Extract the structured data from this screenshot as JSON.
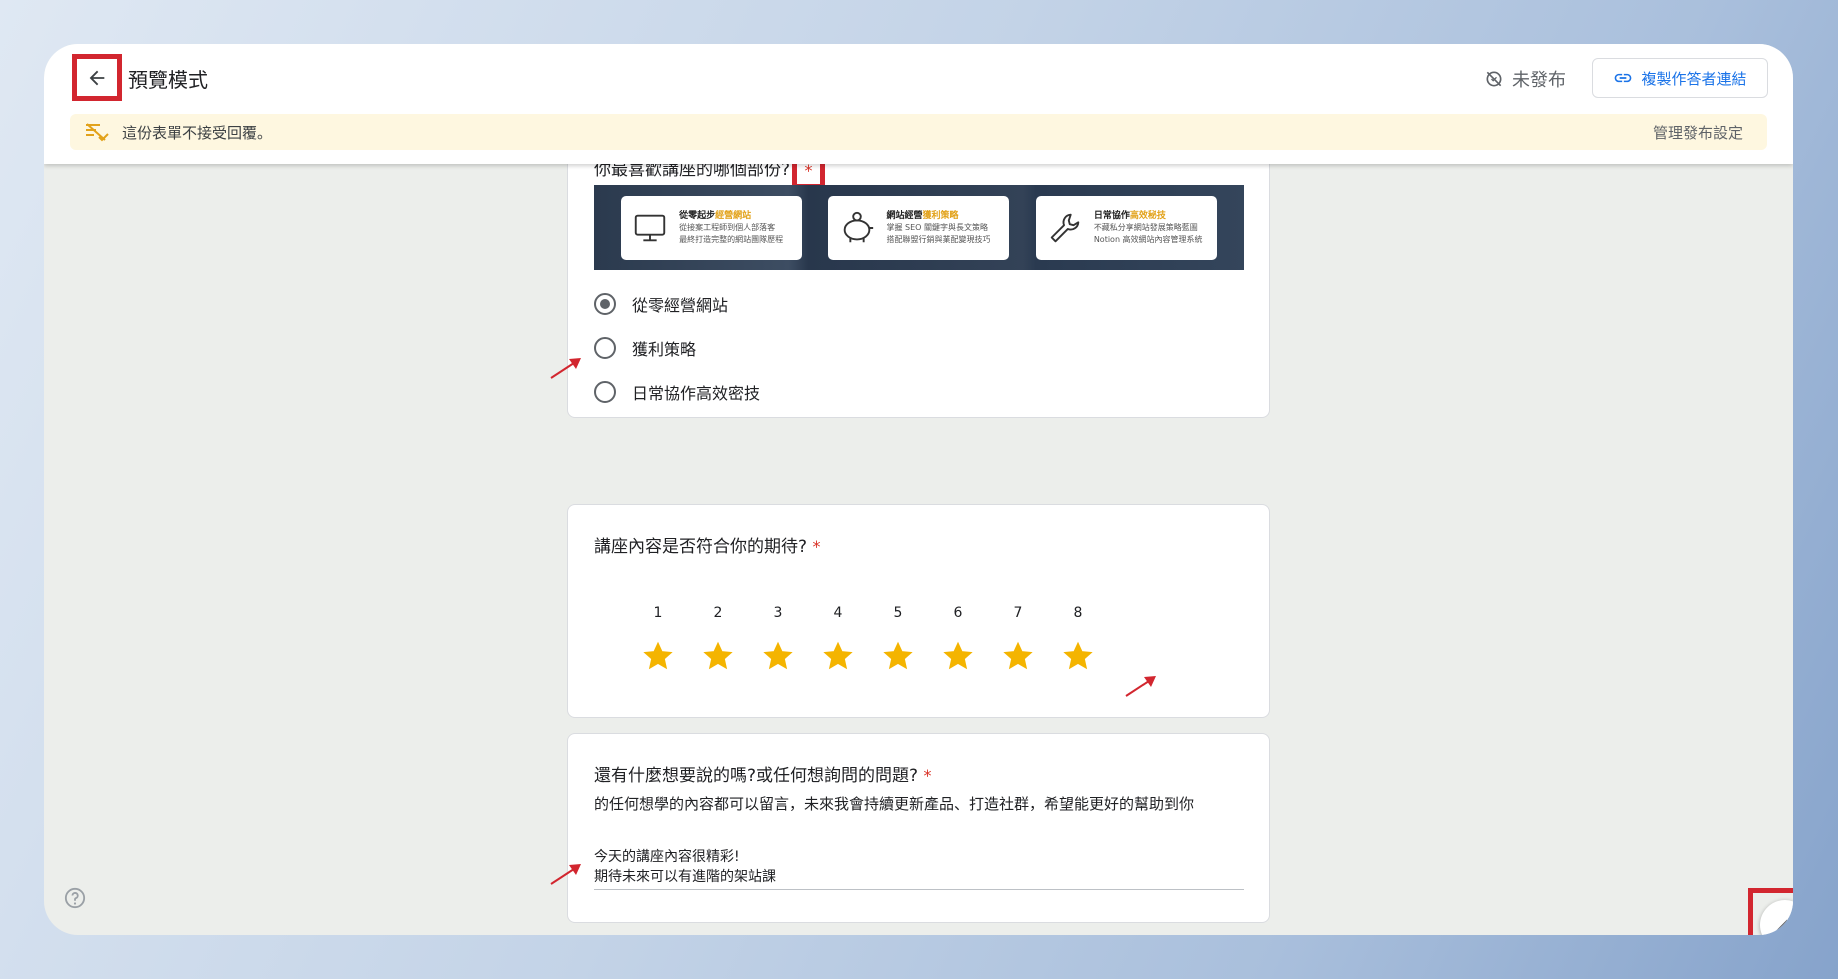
{
  "header": {
    "title": "預覽模式",
    "status": "未發布",
    "copy_link_label": "複製作答者連結"
  },
  "banner": {
    "message": "這份表單不接受回覆。",
    "settings_link": "管理發布設定"
  },
  "questions": [
    {
      "title": "你最喜歡講座的哪個部份?",
      "required": "*",
      "image_cards": [
        {
          "title_plain": "從零起步",
          "title_accent": "經營網站",
          "line1": "從接案工程師到個人部落客",
          "line2": "最終打造完整的網站團隊歷程",
          "icon": "monitor-icon"
        },
        {
          "title_plain": "網站經營",
          "title_accent": "獲利策略",
          "line1": "掌握 SEO 關鍵字與長文策略",
          "line2": "搭配聯盟行銷與業配變現技巧",
          "icon": "piggy-bank-icon"
        },
        {
          "title_plain": "日常協作",
          "title_accent": "高效秘技",
          "line1": "不藏私分享網站發展策略藍圖",
          "line2": "Notion 高效網站內容管理系統",
          "icon": "wrench-icon"
        }
      ],
      "options": [
        "從零經營網站",
        "獲利策略",
        "日常協作高效密技"
      ],
      "selected_index": 0
    },
    {
      "title": "講座內容是否符合你的期待?",
      "required": "*",
      "scale": [
        "1",
        "2",
        "3",
        "4",
        "5",
        "6",
        "7",
        "8"
      ],
      "rating": 8
    },
    {
      "title": "還有什麼想要說的嗎?或任何想詢問的問題?",
      "required": "*",
      "description": "的任何想學的內容都可以留言，未來我會持續更新產品、打造社群，希望能更好的幫助到你",
      "answer_line1": "今天的講座內容很精彩!",
      "answer_line2": "期待未來可以有進階的架站課"
    }
  ],
  "colors": {
    "highlight": "#d2262f",
    "star": "#f4b400",
    "required": "#d93025",
    "link": "#1a73e8",
    "banner_bg": "#fef7e0"
  }
}
